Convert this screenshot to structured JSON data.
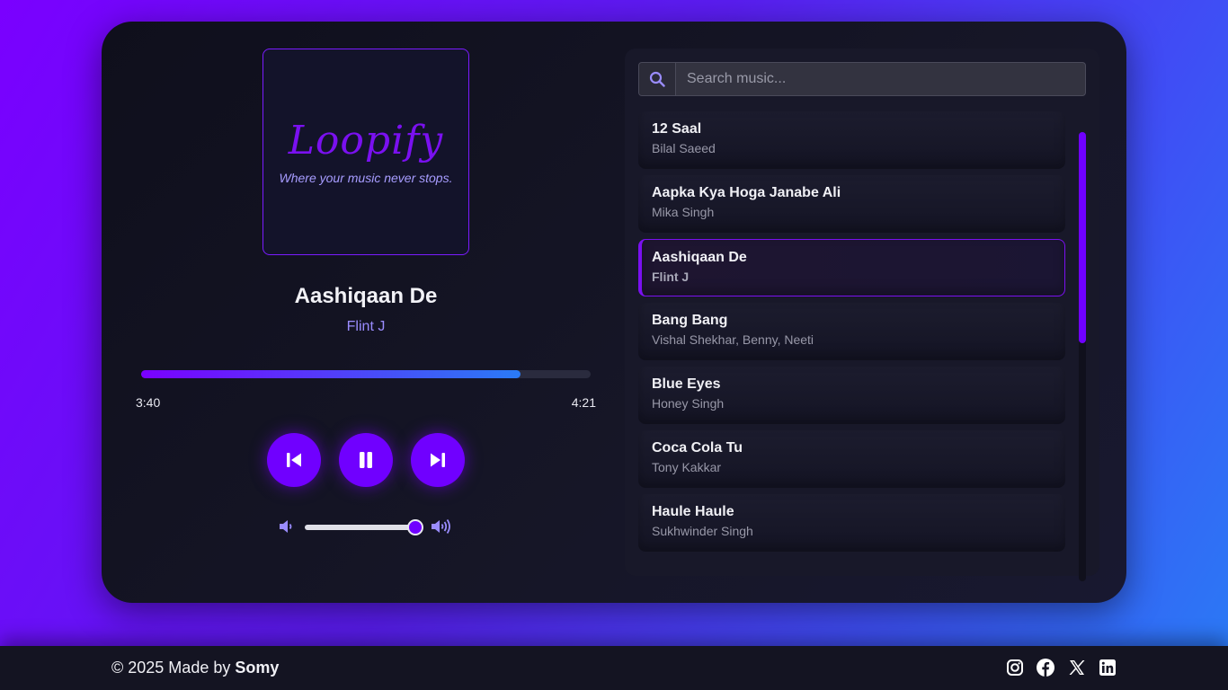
{
  "player": {
    "logo": "Loopify",
    "tagline": "Where your music never stops.",
    "title": "Aashiqaan De",
    "artist": "Flint J",
    "current_time": "3:40",
    "total_time": "4:21",
    "progress_fraction": 0.843,
    "volume_fraction": 1.0,
    "accent": "#7000ff"
  },
  "search": {
    "placeholder": "Search music..."
  },
  "songs": [
    {
      "title": "12 Saal",
      "artist": "Bilal Saeed"
    },
    {
      "title": "Aapka Kya Hoga Janabe Ali",
      "artist": "Mika Singh"
    },
    {
      "title": "Aashiqaan De",
      "artist": "Flint J"
    },
    {
      "title": "Bang Bang",
      "artist": "Vishal Shekhar, Benny, Neeti"
    },
    {
      "title": "Blue Eyes",
      "artist": "Honey Singh"
    },
    {
      "title": "Coca Cola Tu",
      "artist": "Tony Kakkar"
    },
    {
      "title": "Haule Haule",
      "artist": "Sukhwinder Singh"
    }
  ],
  "footer": {
    "copyright_prefix": "© 2025 Made by",
    "author": "Somy",
    "social": [
      "instagram-icon",
      "facebook-icon",
      "x-icon",
      "linkedin-icon"
    ]
  }
}
